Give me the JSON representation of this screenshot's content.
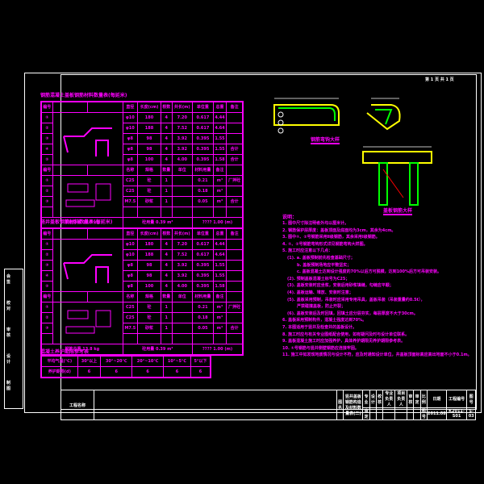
{
  "sheet": {
    "label": "第 1 页 共 1 页"
  },
  "table1": {
    "title": "钢筋混凝土盖板钢筋材料数量表(每延米)",
    "header": [
      "编号",
      "",
      "",
      "直径",
      "长度(cm)",
      "根数",
      "共长(m)",
      "单位重",
      "总重",
      "备注"
    ],
    "rows": [
      [
        "①",
        "φ10",
        "180",
        "4",
        "7.20",
        "0.617",
        "4.44",
        ""
      ],
      [
        "②",
        "φ10",
        "188",
        "4",
        "7.52",
        "0.617",
        "4.64",
        ""
      ],
      [
        "③",
        "φ8",
        "98",
        "4",
        "3.92",
        "0.395",
        "1.55",
        ""
      ],
      [
        "④",
        "φ8",
        "98",
        "4",
        "3.92",
        "0.395",
        "1.55",
        "合计"
      ],
      [
        "⑤",
        "φ8",
        "100",
        "4",
        "4.00",
        "0.395",
        "1.58",
        "合计"
      ]
    ],
    "header2": [
      "编号",
      "",
      "",
      "名称",
      "规格",
      "数量",
      "单位",
      "材料用量",
      "备注"
    ],
    "rows2": [
      [
        "①",
        "C25",
        "砼",
        "1",
        "",
        "0.21",
        "m³",
        "厂拌砼"
      ],
      [
        "②",
        "C25",
        "砼",
        "1",
        "",
        "0.18",
        "m³",
        ""
      ],
      [
        "③",
        "M7.5",
        "砂浆",
        "1",
        "",
        "0.05",
        "m³",
        "合计"
      ],
      [
        "",
        "",
        "",
        "",
        "",
        "",
        "",
        ""
      ]
    ],
    "footer": [
      "钢筋总重 13.8 kg",
      "砼用量 0.39 m³",
      "???? 1.00 (m)"
    ]
  },
  "table2": {
    "title": "竖井盖板钢筋材料数量表(每延米)",
    "header": [
      "编号",
      "",
      "",
      "直径",
      "长度(cm)",
      "根数",
      "共长(m)",
      "单位重",
      "总重",
      "备注"
    ],
    "rows": [
      [
        "①",
        "φ10",
        "180",
        "4",
        "7.20",
        "0.617",
        "4.44",
        ""
      ],
      [
        "②",
        "φ10",
        "188",
        "4",
        "7.52",
        "0.617",
        "4.64",
        ""
      ],
      [
        "③",
        "φ8",
        "98",
        "4",
        "3.92",
        "0.395",
        "1.55",
        ""
      ],
      [
        "④",
        "φ8",
        "98",
        "4",
        "3.92",
        "0.395",
        "1.55",
        ""
      ],
      [
        "⑤",
        "φ8",
        "100",
        "4",
        "4.00",
        "0.395",
        "1.58",
        ""
      ]
    ],
    "header2": [
      "编号",
      "",
      "",
      "名称",
      "规格",
      "数量",
      "单位",
      "材料用量",
      "备注"
    ],
    "rows2": [
      [
        "①",
        "C25",
        "砼",
        "1",
        "",
        "0.21",
        "m³",
        "厂拌砼"
      ],
      [
        "②",
        "C25",
        "砼",
        "1",
        "",
        "0.18",
        "m³",
        ""
      ],
      [
        "③",
        "M7.5",
        "砂浆",
        "1",
        "",
        "0.05",
        "m³",
        "合计"
      ],
      [
        "",
        "",
        "",
        "",
        "",
        "",
        "",
        ""
      ]
    ],
    "footer": [
      "钢筋总重 13.8 kg",
      "砼用量 0.39 m³",
      "???? 1.00 (m)"
    ]
  },
  "table3": {
    "title": "混凝土养护期限参考表",
    "header": [
      "平均气温(℃)",
      "30°以上",
      "30°~20℃",
      "20°~10℃",
      "10°~5℃",
      "5°以下"
    ],
    "row": [
      "养护期限(d)",
      "6",
      "6",
      "6",
      "6",
      "6"
    ]
  },
  "drawings": {
    "label1": "钢筋弯钩大样",
    "label2": "盖板钢筋大样"
  },
  "notes": {
    "title": "说明：",
    "items": [
      "1. 图中尺寸除注明者外均以厘米计。",
      "2. 钢筋保护层厚度：盖板顶面及底面均为3cm，其余为4cm。",
      "3. 图中①、②号钢筋采用Ⅱ级钢筋，其余采用Ⅰ级钢筋。",
      "4. ①、②号钢筋弯钩形式详见钢筋弯钩大样图。",
      "5. 施工时应注意以下几点：",
      "(1). a. 盖板预制前先检查基础尺寸；",
      "b. 盖板预制场地应平整坚实；",
      "c. 盖板混凝土达到设计强度的70%以后方可脱模，达到100%后方可吊装安装。",
      "(2). 预制盖板混凝土标号为C25；",
      "(3). 盖板安装时应坐浆，安装后用砂浆填缝，勾缝应平顺；",
      "(4). 盖板运输、堆放、安装时注意；",
      "(5). 盖板采用预制，吊装时应采用专用吊具，盖板吊装（吊装重量约0.5t），",
      "严禁碰撞盖板，防止开裂；",
      "(6). 盖板安装后及时回填，回填土应分层夯实，每层厚度不大于30cm。",
      "6. 盖板采用预制构件，混凝土强度达到70%。",
      "7. 本图适用于竖井及检查井的盖板设计。",
      "8. 施工时应与有关专业图纸配合使用，如有疑问及时与设计单位联系。",
      "9. 盖板混凝土施工时应加强养护，具体养护期限见养护期限参考表。",
      "10. ①号钢筋与竖井侧壁钢筋应连接牢固。",
      "11. 施工中如发现地质情况与设计不符，应及时通知设计单位，井盖板顶面标高应高出地面不小于0.1m。"
    ]
  },
  "titleblock": {
    "project_label": "工程名称",
    "drawing_label": "图名",
    "drawing_name": [
      "竖井盖板钢筋构造",
      "及材料数量表(二)"
    ],
    "cols": [
      "专业",
      "设计",
      "校核",
      "专业负责人",
      "项目负责人",
      "审核",
      "审定",
      "比例",
      "日期",
      "工程编号",
      "图号"
    ],
    "row2": [
      "审定",
      "",
      "",
      "",
      "",
      "",
      "",
      "图号",
      "2011.08",
      "K2011-S01",
      "S-03"
    ],
    "left_strip": [
      "会签",
      "校对",
      "审核",
      "设计",
      "制图"
    ]
  }
}
